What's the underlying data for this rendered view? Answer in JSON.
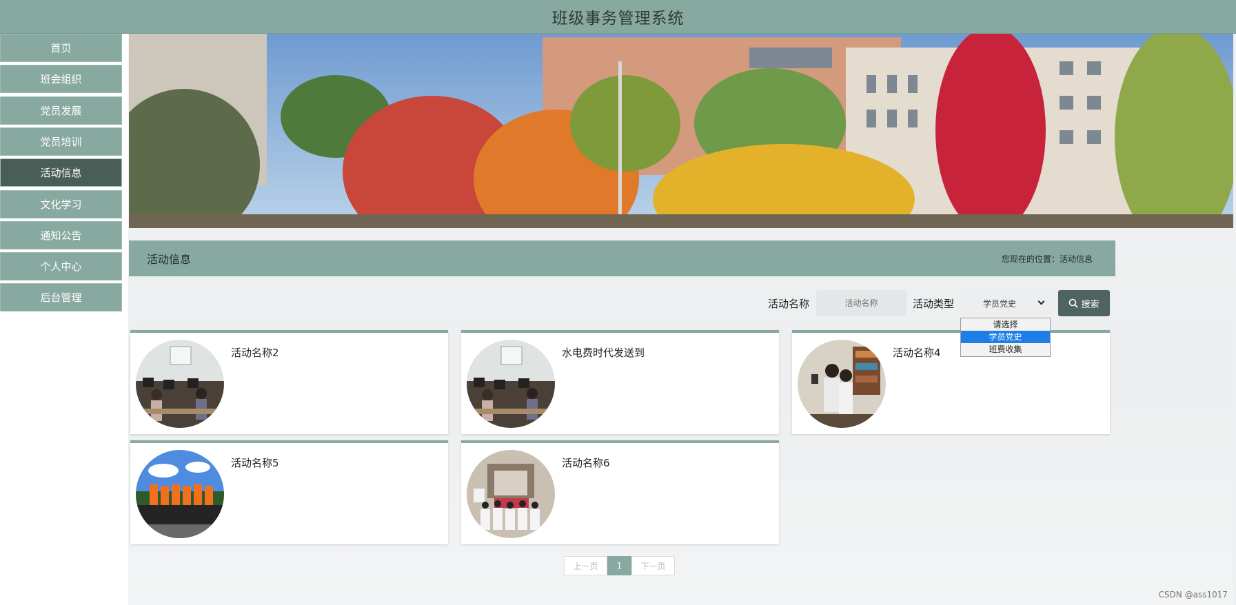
{
  "app": {
    "title": "班级事务管理系统"
  },
  "sidebar": {
    "items": [
      {
        "label": "首页"
      },
      {
        "label": "班会组织"
      },
      {
        "label": "党员发展"
      },
      {
        "label": "党员培训"
      },
      {
        "label": "活动信息"
      },
      {
        "label": "文化学习"
      },
      {
        "label": "通知公告"
      },
      {
        "label": "个人中心"
      },
      {
        "label": "后台管理"
      }
    ],
    "active_index": 4
  },
  "section": {
    "title": "活动信息",
    "breadcrumb": "您现在的位置：活动信息"
  },
  "search": {
    "name_label": "活动名称",
    "name_placeholder": "活动名称",
    "type_label": "活动类型",
    "type_value": "学员党史",
    "button_label": "搜索",
    "options": [
      "请选择",
      "学员党史",
      "班费收集"
    ],
    "selected_option": "学员党史"
  },
  "cards": [
    {
      "name": "活动名称2",
      "thumb": "classroom-photo"
    },
    {
      "name": "水电费时代发送到",
      "thumb": "classroom-photo"
    },
    {
      "name": "活动名称4",
      "thumb": "meeting-photo"
    },
    {
      "name": "活动名称5",
      "thumb": "outdoor-group-photo"
    },
    {
      "name": "活动名称6",
      "thumb": "auditorium-photo"
    }
  ],
  "pagination": {
    "prev": "上一页",
    "current": "1",
    "next": "下一页"
  },
  "watermark": "CSDN @ass1017",
  "colors": {
    "header": "#87a9a0",
    "active_nav": "#4a5e58",
    "button": "#4f645f",
    "select_highlight": "#1e7ee8"
  }
}
